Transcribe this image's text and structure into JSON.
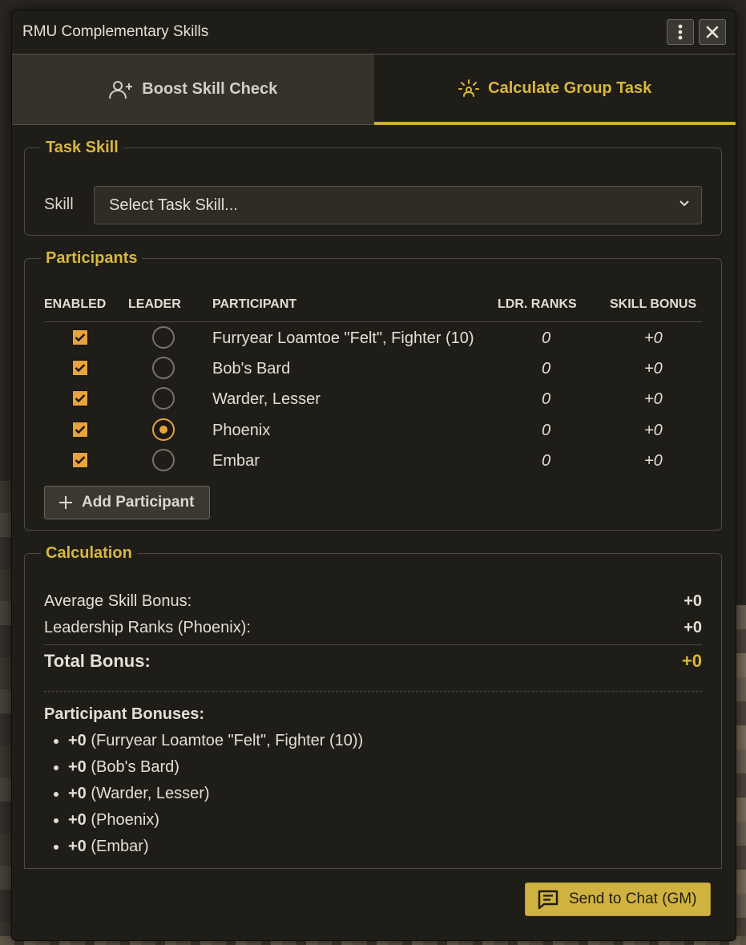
{
  "window": {
    "title": "RMU Complementary Skills",
    "menu_icon": "kebab-menu-icon",
    "close_icon": "close-icon"
  },
  "tabs": [
    {
      "label": "Boost Skill Check",
      "icon": "user-plus-icon",
      "active": false
    },
    {
      "label": "Calculate Group Task",
      "icon": "users-sparkle-icon",
      "active": true
    }
  ],
  "task_skill": {
    "legend": "Task Skill",
    "skill_label": "Skill",
    "select_value": "Select Task Skill..."
  },
  "participants": {
    "legend": "Participants",
    "columns": [
      "ENABLED",
      "LEADER",
      "PARTICIPANT",
      "LDR. RANKS",
      "SKILL BONUS"
    ],
    "rows": [
      {
        "enabled": true,
        "leader": false,
        "name": "Furryear Loamtoe \"Felt\", Fighter (10)",
        "ranks": "0",
        "bonus": "+0"
      },
      {
        "enabled": true,
        "leader": false,
        "name": "Bob's Bard",
        "ranks": "0",
        "bonus": "+0"
      },
      {
        "enabled": true,
        "leader": false,
        "name": "Warder, Lesser",
        "ranks": "0",
        "bonus": "+0"
      },
      {
        "enabled": true,
        "leader": true,
        "name": "Phoenix",
        "ranks": "0",
        "bonus": "+0"
      },
      {
        "enabled": true,
        "leader": false,
        "name": "Embar",
        "ranks": "0",
        "bonus": "+0"
      }
    ],
    "add_button": "Add Participant"
  },
  "calculation": {
    "legend": "Calculation",
    "avg_label": "Average Skill Bonus:",
    "avg_value": "+0",
    "leader_label": "Leadership Ranks (Phoenix):",
    "leader_value": "+0",
    "total_label": "Total Bonus:",
    "total_value": "+0",
    "pb_title": "Participant Bonuses:",
    "bonuses": [
      {
        "value": "+0",
        "name": "(Furryear Loamtoe \"Felt\", Fighter (10))"
      },
      {
        "value": "+0",
        "name": "(Bob's Bard)"
      },
      {
        "value": "+0",
        "name": "(Warder, Lesser)"
      },
      {
        "value": "+0",
        "name": "(Phoenix)"
      },
      {
        "value": "+0",
        "name": "(Embar)"
      }
    ]
  },
  "send_button": "Send to Chat (GM)",
  "colors": {
    "accent": "#d8b73e",
    "checkbox": "#e8a33c",
    "panel": "#1f1d18"
  }
}
